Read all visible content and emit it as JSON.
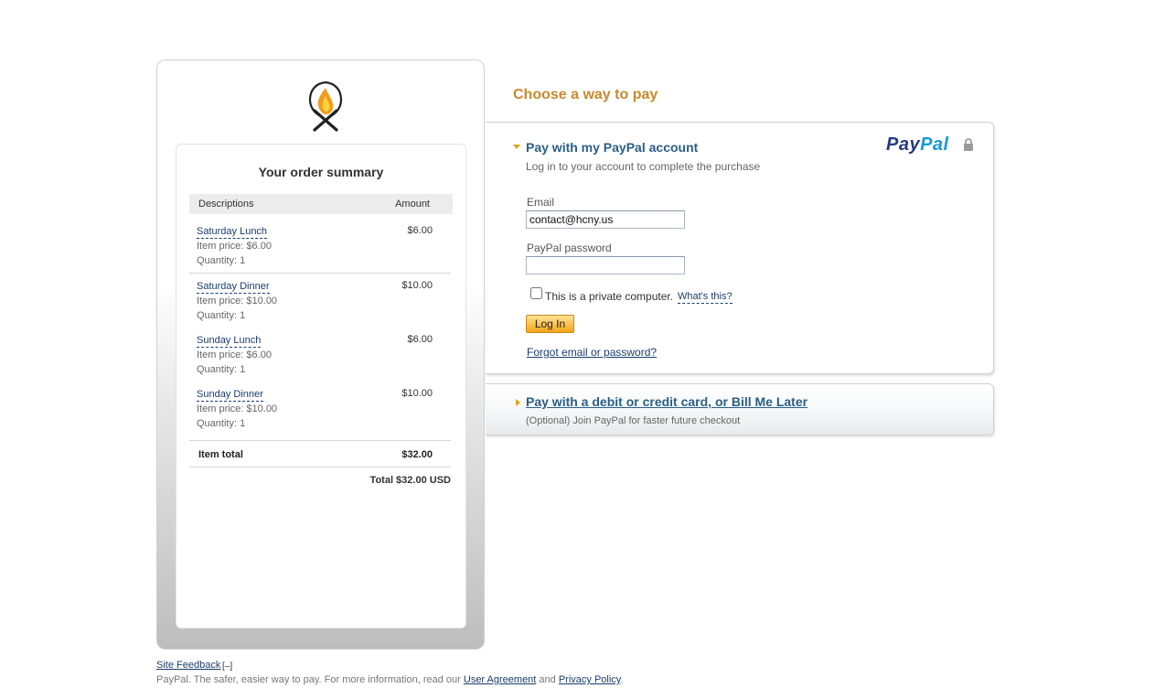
{
  "order_summary": {
    "title": "Your order summary",
    "col_descriptions": "Descriptions",
    "col_amount": "Amount",
    "items": [
      {
        "name": "Saturday Lunch",
        "price": "Item price: $6.00",
        "quantity": "Quantity: 1",
        "amount": "$6.00"
      },
      {
        "name": "Saturday Dinner",
        "price": "Item price: $10.00",
        "quantity": "Quantity: 1",
        "amount": "$10.00"
      },
      {
        "name": "Sunday Lunch",
        "price": "Item price: $6.00",
        "quantity": "Quantity: 1",
        "amount": "$6.00"
      },
      {
        "name": "Sunday Dinner",
        "price": "Item price: $10.00",
        "quantity": "Quantity: 1",
        "amount": "$10.00"
      }
    ],
    "item_total_label": "Item total",
    "item_total_value": "$32.00",
    "grand_total": "Total $32.00 USD"
  },
  "payment": {
    "heading": "Choose a way to pay",
    "paypal_section": {
      "title": "Pay with my PayPal account",
      "subtitle": "Log in to your account to complete the purchase",
      "logo_pay": "Pay",
      "logo_pal": "Pal",
      "email_label": "Email",
      "email_value": "contact@hcny.us",
      "password_label": "PayPal password",
      "password_value": "",
      "private_computer_label": "This is a private computer.",
      "whats_this": "What's this?",
      "login_button": "Log In",
      "forgot_link": "Forgot email or password?"
    },
    "card_section": {
      "title": "Pay with a debit or credit card, or Bill Me Later",
      "subtitle": "(Optional) Join PayPal for faster future checkout"
    }
  },
  "footer": {
    "site_feedback": "Site Feedback",
    "feedback_toggle": "[–]",
    "tagline": "PayPal. The safer, easier way to pay. For more information, read our",
    "user_agreement": "User Agreement",
    "and": "and",
    "privacy_policy": "Privacy Policy",
    "period": "."
  },
  "colors": {
    "heading_orange": "#c8892c",
    "link_blue": "#1a3e6b",
    "section_title_blue": "#2a5f86",
    "paypal_dark_blue": "#253b80",
    "paypal_light_blue": "#179bd7",
    "accent_triangle": "#d9a51b"
  },
  "icons": {
    "merchant_logo": "campfire-logo",
    "lock": "lock-icon",
    "expanded": "triangle-down-icon",
    "collapsed": "triangle-right-icon"
  }
}
